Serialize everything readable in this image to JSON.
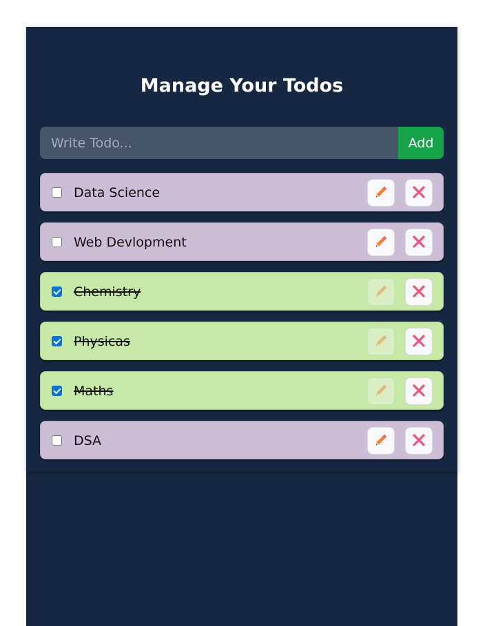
{
  "header": {
    "title": "Manage Your Todos"
  },
  "form": {
    "placeholder": "Write Todo...",
    "value": "",
    "add_label": "Add"
  },
  "todos": [
    {
      "text": "Data Science",
      "completed": false
    },
    {
      "text": "Web Devlopment",
      "completed": false
    },
    {
      "text": "Chemistry",
      "completed": true
    },
    {
      "text": "Physicas",
      "completed": true
    },
    {
      "text": "Maths",
      "completed": true
    },
    {
      "text": "DSA",
      "completed": false
    }
  ],
  "icons": {
    "edit": "pencil-icon",
    "delete": "close-icon"
  },
  "colors": {
    "app_bg": "#172842",
    "pending_bg": "#ccbed7",
    "done_bg": "#c6e9a7",
    "add_button": "#16a34a",
    "input_bg": "#475569",
    "pencil": "#f57c30",
    "delete_x": "#e8557a"
  }
}
